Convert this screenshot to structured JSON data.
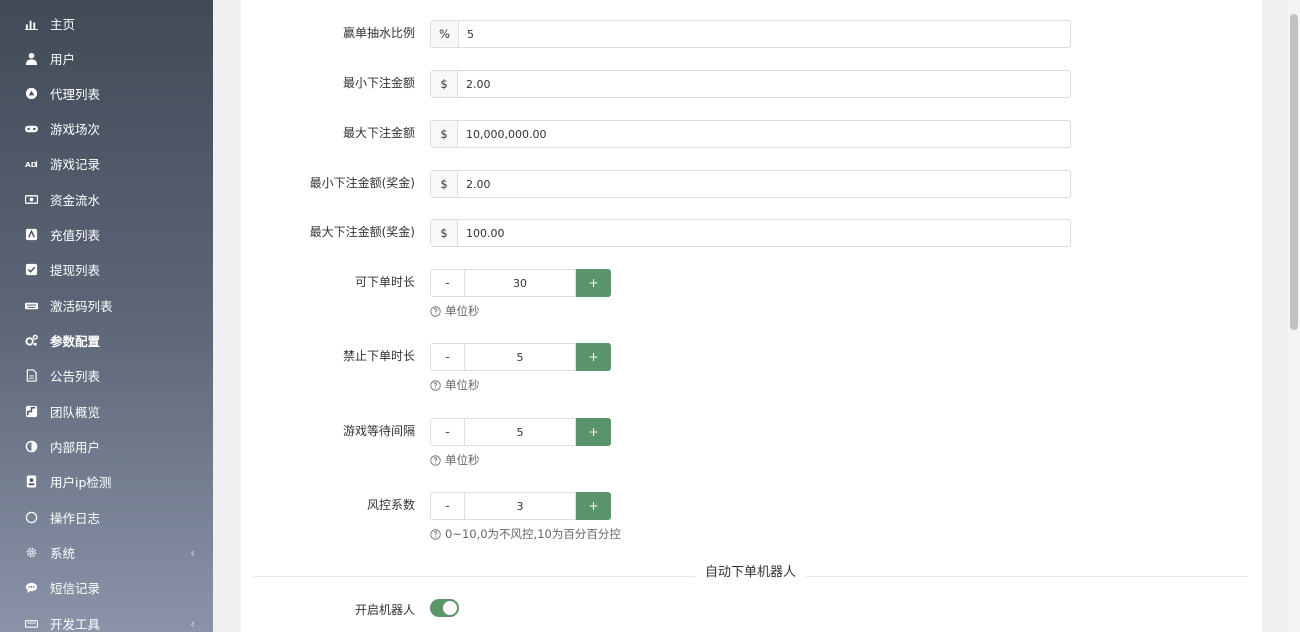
{
  "sidebar": {
    "items": [
      {
        "label": "主页",
        "icon": "bar-chart-icon"
      },
      {
        "label": "用户",
        "icon": "user-icon"
      },
      {
        "label": "代理列表",
        "icon": "agent-circle-icon"
      },
      {
        "label": "游戏场次",
        "icon": "gamepad-icon"
      },
      {
        "label": "游戏记录",
        "icon": "ad-icon"
      },
      {
        "label": "资金流水",
        "icon": "money-icon"
      },
      {
        "label": "充值列表",
        "icon": "recharge-icon"
      },
      {
        "label": "提现列表",
        "icon": "checkbox-icon"
      },
      {
        "label": "激活码列表",
        "icon": "keyboard-icon"
      },
      {
        "label": "参数配置",
        "icon": "gears-icon",
        "active": true
      },
      {
        "label": "公告列表",
        "icon": "document-icon"
      },
      {
        "label": "团队概览",
        "icon": "team-icon"
      },
      {
        "label": "内部用户",
        "icon": "half-circle-icon"
      },
      {
        "label": "用户ip检测",
        "icon": "id-badge-icon"
      },
      {
        "label": "操作日志",
        "icon": "circle-icon"
      },
      {
        "label": "系统",
        "icon": "cog-icon",
        "chevron": "‹"
      },
      {
        "label": "短信记录",
        "icon": "sms-icon"
      },
      {
        "label": "开发工具",
        "icon": "tools-icon",
        "chevron": "‹"
      }
    ]
  },
  "form": {
    "fields": [
      {
        "label": "赢单抽水比例",
        "addon": "%",
        "value": "5"
      },
      {
        "label": "最小下注金额",
        "addon": "$",
        "value": "2.00"
      },
      {
        "label": "最大下注金额",
        "addon": "$",
        "value": "10,000,000.00"
      },
      {
        "label": "最小下注金额(奖金)",
        "addon": "$",
        "value": "2.00"
      },
      {
        "label": "最大下注金额(奖金)",
        "addon": "$",
        "value": "100.00"
      }
    ],
    "steppers": [
      {
        "label": "可下单时长",
        "value": "30",
        "minus": "-",
        "plus": "+",
        "help": "单位秒"
      },
      {
        "label": "禁止下单时长",
        "value": "5",
        "minus": "-",
        "plus": "+",
        "help": "单位秒"
      },
      {
        "label": "游戏等待间隔",
        "value": "5",
        "minus": "-",
        "plus": "+",
        "help": "单位秒"
      },
      {
        "label": "风控系数",
        "value": "3",
        "minus": "-",
        "plus": "+",
        "help": "0~10,0为不风控,10为百分百分控"
      }
    ],
    "section_title": "自动下单机器人",
    "robot": {
      "label": "开启机器人",
      "enabled": true
    }
  },
  "colors": {
    "accent": "#5a946a",
    "sidebar_top": "#414a56",
    "sidebar_bottom": "#8a93a8"
  }
}
